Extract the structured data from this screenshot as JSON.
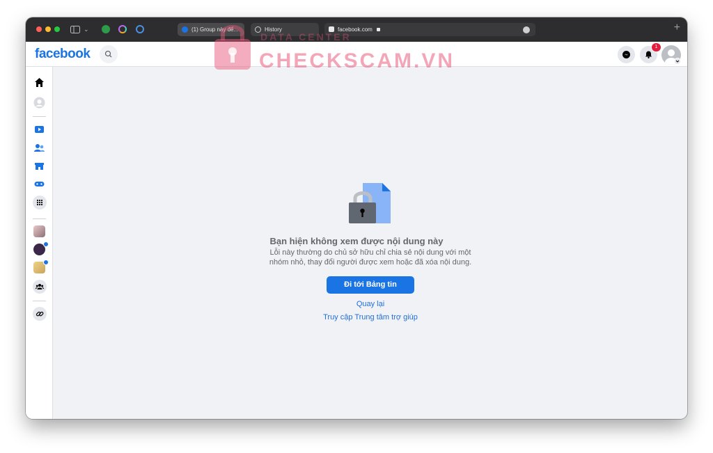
{
  "browser": {
    "tabs": [
      {
        "label": "(1) Group này để..."
      },
      {
        "label": "History"
      }
    ],
    "address": "facebook.com",
    "new_tab": "+"
  },
  "watermark": {
    "sub": "DATA CENTER",
    "text": "CHECKSCAM.VN"
  },
  "header": {
    "logo": "facebook",
    "notification_count": "1"
  },
  "sidebar": {
    "items": [
      "home-icon",
      "profile-icon",
      "watch-icon",
      "friends-icon",
      "marketplace-icon",
      "gaming-icon",
      "menu-grid-icon",
      "group-icon",
      "group-icon",
      "group-icon",
      "groups-icon",
      "link-icon"
    ]
  },
  "content": {
    "title": "Bạn hiện không xem được nội dung này",
    "description": "Lỗi này thường do chủ sở hữu chỉ chia sẻ nội dung với một nhóm nhỏ, thay đổi người được xem hoặc đã xóa nội dung.",
    "primary_button": "Đi tới Bảng tin",
    "back_link": "Quay lại",
    "help_link": "Truy cập Trung tâm trợ giúp"
  },
  "colors": {
    "brand": "#1b74e4",
    "badge": "#e41e3f",
    "watermark": "#e95c7d"
  }
}
